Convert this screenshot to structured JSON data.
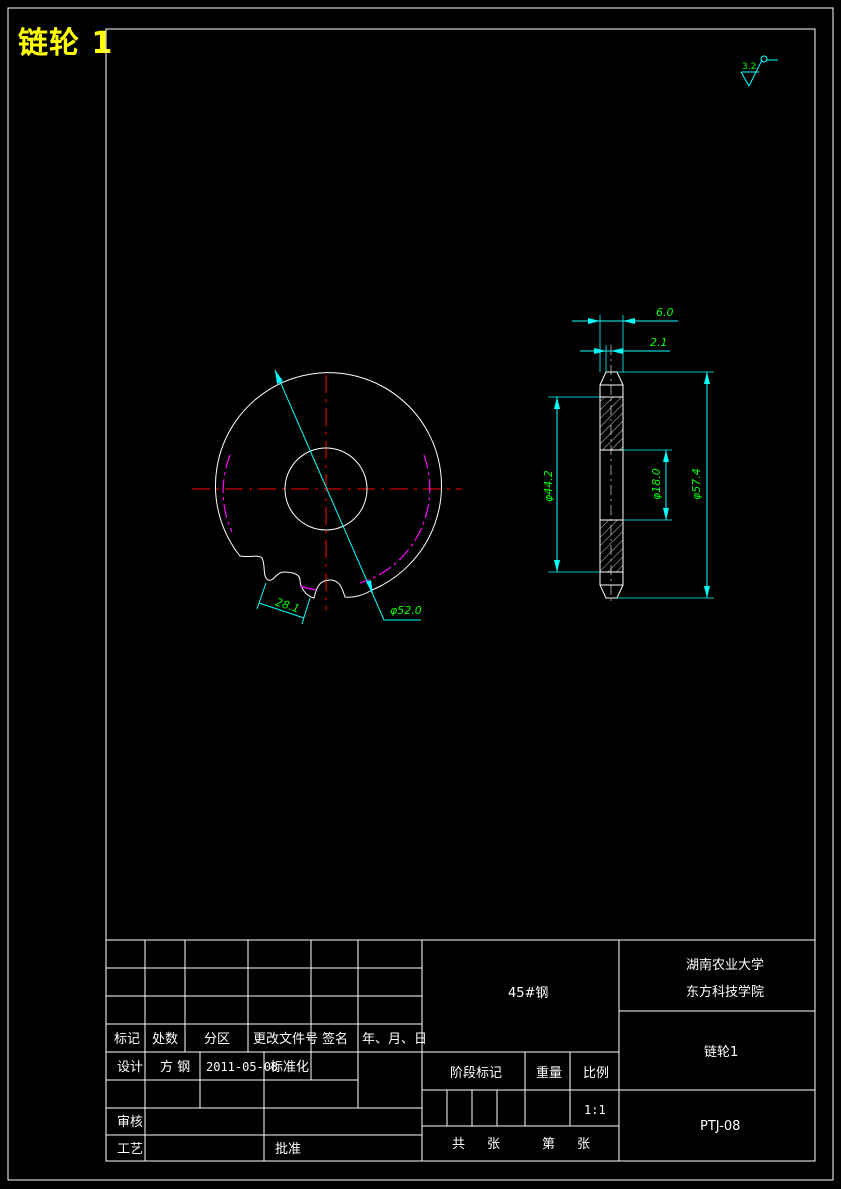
{
  "drawing_title": "链轮 1",
  "roughness_value": "3.2",
  "dimensions": {
    "tooth_chord": "28.1",
    "pitch_dia": "φ52.0",
    "width": "6.0",
    "hub_offset": "2.1",
    "dia_44": "φ44.2",
    "bore": "φ18.0",
    "outer_dia": "φ57.4"
  },
  "title_block": {
    "material": "45#钢",
    "university_line1": "湖南农业大学",
    "university_line2": "东方科技学院",
    "part_name": "链轮1",
    "drawing_no": "PTJ-08",
    "headers": [
      "标记",
      "处数",
      "分区",
      "更改文件号",
      "签名",
      "年、月、日"
    ],
    "design_label": "设计",
    "designer": "方 钢",
    "date": "2011-05-08",
    "standardize_label": "标准化",
    "review_label": "审核",
    "process_label": "工艺",
    "approve_label": "批准",
    "stage_label": "阶段标记",
    "weight_label": "重量",
    "scale_label": "比例",
    "scale_value": "1:1",
    "total_label": "共",
    "sheet_label": "张",
    "page_label": "第",
    "page_sheet_label": "张"
  }
}
